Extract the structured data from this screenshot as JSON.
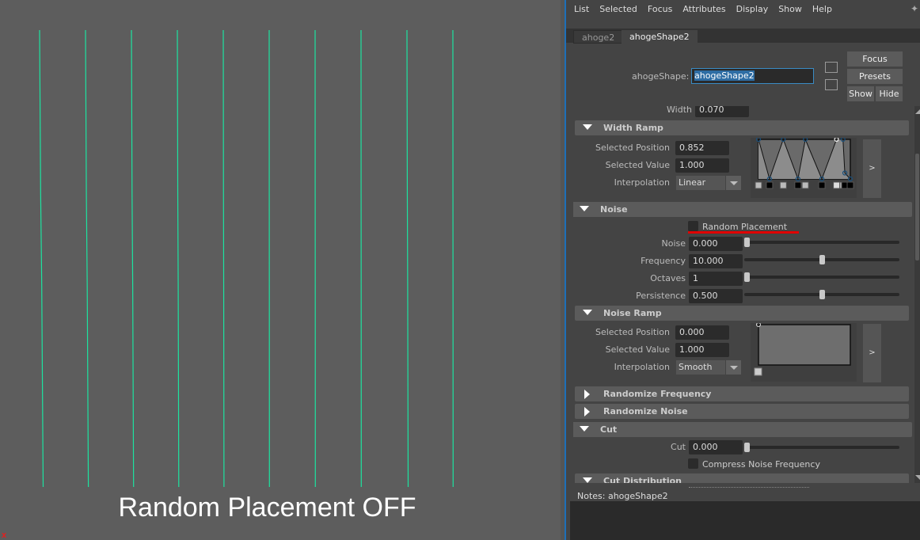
{
  "viewport": {
    "caption": "Random Placement OFF",
    "axis_label": "X",
    "curve_color": "#1de3a0",
    "curve_count": 10
  },
  "menu": [
    "List",
    "Selected",
    "Focus",
    "Attributes",
    "Display",
    "Show",
    "Help"
  ],
  "tabs": [
    {
      "label": "ahoge2",
      "active": false
    },
    {
      "label": "ahogeShape2",
      "active": true
    }
  ],
  "header": {
    "node_type_label": "ahogeShape:",
    "node_name": "ahogeShape2",
    "buttons": {
      "focus": "Focus",
      "presets": "Presets",
      "show": "Show",
      "hide": "Hide"
    }
  },
  "width_partial": {
    "label": "Width",
    "value": "0.070"
  },
  "width_ramp": {
    "title": "Width Ramp",
    "selected_position_label": "Selected Position",
    "selected_position": "0.852",
    "selected_value_label": "Selected Value",
    "selected_value": "1.000",
    "interpolation_label": "Interpolation",
    "interpolation": "Linear",
    "expand": ">",
    "points": [
      [
        0.0,
        1.0
      ],
      [
        0.12,
        0.0
      ],
      [
        0.27,
        1.0
      ],
      [
        0.43,
        0.0
      ],
      [
        0.51,
        1.0
      ],
      [
        0.69,
        0.0
      ],
      [
        0.85,
        1.0
      ],
      [
        0.92,
        1.0
      ],
      [
        0.94,
        0.15
      ],
      [
        1.0,
        0.0
      ]
    ]
  },
  "noise": {
    "title": "Noise",
    "random_placement_label": "Random Placement",
    "random_placement": false,
    "rows": [
      {
        "label": "Noise",
        "value": "0.000",
        "slider": 0.0
      },
      {
        "label": "Frequency",
        "value": "10.000",
        "slider": 0.5
      },
      {
        "label": "Octaves",
        "value": "1",
        "slider": 0.0
      },
      {
        "label": "Persistence",
        "value": "0.500",
        "slider": 0.5
      }
    ]
  },
  "noise_ramp": {
    "title": "Noise Ramp",
    "selected_position_label": "Selected Position",
    "selected_position": "0.000",
    "selected_value_label": "Selected Value",
    "selected_value": "1.000",
    "interpolation_label": "Interpolation",
    "interpolation": "Smooth",
    "expand": ">"
  },
  "collapsed_sections": [
    "Randomize Frequency",
    "Randomize Noise"
  ],
  "cut": {
    "title": "Cut",
    "cut_label": "Cut",
    "cut_value": "0.000",
    "cut_slider": 0.0,
    "compress_label": "Compress Noise Frequency",
    "compress": false
  },
  "cut_distribution": {
    "title": "Cut Distribution"
  },
  "notes": {
    "label": "Notes:  ahogeShape2",
    "text": ""
  }
}
